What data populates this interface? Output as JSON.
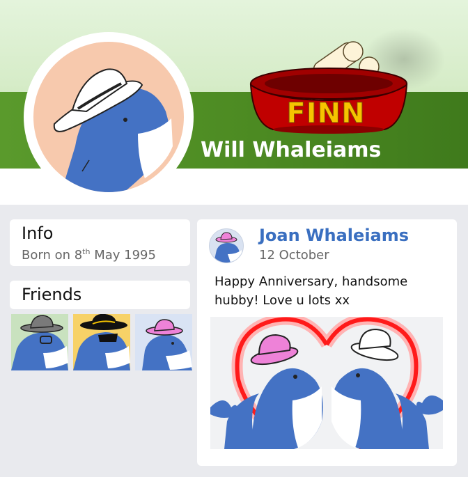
{
  "profile": {
    "name": "Will Whaleiams",
    "cover_bowl_text": "FINN"
  },
  "info": {
    "title": "Info",
    "born_prefix": "Born on 8",
    "born_sup": "th",
    "born_suffix": " May 1995"
  },
  "friends": {
    "title": "Friends",
    "items": [
      {
        "hat": "grey-hat",
        "glasses": "clear-glasses",
        "bg": "#c9e2bf"
      },
      {
        "hat": "black-hat",
        "glasses": "sunglasses",
        "bg": "#f7d267"
      },
      {
        "hat": "pink-hat",
        "glasses": "none",
        "bg": "#d9e3f4"
      }
    ]
  },
  "post": {
    "author": "Joan Whaleiams",
    "date": "12 October",
    "text": "Happy Anniversary, handsome hubby! Love u lots xx"
  },
  "colors": {
    "whale_blue": "#4472c4",
    "author_blue": "#3a6fc0",
    "heart_red": "#ff1a1a",
    "bowl_red": "#c00000",
    "pink_hat": "#ee82d8"
  }
}
